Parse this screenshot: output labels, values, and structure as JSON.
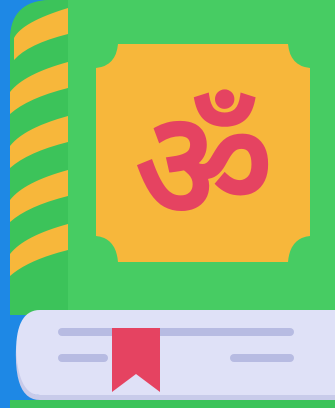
{
  "icon": {
    "name": "holy-book-om-icon",
    "symbol": "ॐ"
  },
  "colors": {
    "background": "#1e88e5",
    "book_green": "#3cc35a",
    "book_green_light": "#52d36a",
    "book_green_dark": "#2fae4c",
    "spine_stripe": "#f7b73b",
    "panel": "#f7b73b",
    "symbol": "#e54361",
    "pages": "#dfe1f7",
    "page_lines": "#b7bbe2",
    "bookmark": "#e54361"
  }
}
